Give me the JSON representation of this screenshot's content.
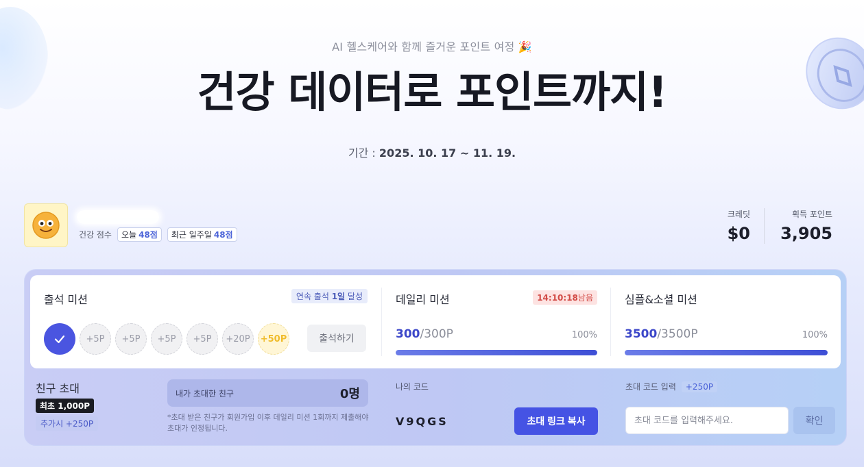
{
  "hero": {
    "subtitle": "AI 헬스케어와 함께 즐거운 포인트 여정 🎉",
    "title": "건강 데이터로 포인트까지!",
    "period_label": "기간 :",
    "period_value": "2025. 10. 17 ~ 11. 19."
  },
  "profile": {
    "score_label": "건강 점수",
    "today_label": "오늘",
    "today_value": "48점",
    "week_label": "최근 일주일",
    "week_value": "48점"
  },
  "stats": {
    "credit_label": "크레딧",
    "credit_value": "$0",
    "points_label": "획득 포인트",
    "points_value": "3,905"
  },
  "attendance": {
    "title": "출석 미션",
    "streak_prefix": "연속 출석 ",
    "streak_count": "1일",
    "streak_suffix": " 달성",
    "rewards": [
      "+5P",
      "+5P",
      "+5P",
      "+5P",
      "+20P",
      "+50P"
    ],
    "checkin_button": "출석하기"
  },
  "daily": {
    "title": "데일리 미션",
    "timer": "14:10:18",
    "timer_suffix": "남음",
    "current": "300",
    "total": "/300P",
    "percent": "100%",
    "progress": 1.0
  },
  "social": {
    "title": "심플&소셜 미션",
    "current": "3500",
    "total": "/3500P",
    "percent": "100%",
    "progress": 1.0
  },
  "invite": {
    "title": "친구 초대",
    "first_badge": "최초 1,000P",
    "add_badge": "추가시 +250P",
    "invited_label": "내가 초대한 친구",
    "invited_count": "0명",
    "note": "*초대 받은 친구가 회원가입 이후 데일리 미션 1회까지 제출해야 초대가 인정됩니다.",
    "my_code_label": "나의 코드",
    "my_code": "V9QGS",
    "copy_button": "초대 링크 복사",
    "code_input_label": "초대 코드 입력",
    "code_input_bonus": "+250P",
    "code_input_placeholder": "초대 코드를 입력해주세요.",
    "confirm_button": "확인"
  },
  "colors": {
    "accent": "#4553e4",
    "progress": "#3e4fd6",
    "gold": "#f0bc2b",
    "timer": "#d24a45"
  }
}
